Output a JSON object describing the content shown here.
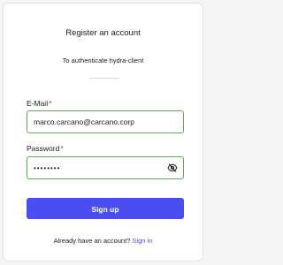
{
  "header": {
    "title": "Register an account",
    "subtitle": "To authenticate hydra-client"
  },
  "form": {
    "email": {
      "label": "E-Mail",
      "required_marker": "*",
      "value": "marco.carcano@carcano.corp"
    },
    "password": {
      "label": "Password",
      "required_marker": "*",
      "value": "password",
      "toggle_icon": "eye-off-icon"
    },
    "submit_label": "Sign up"
  },
  "footer": {
    "prompt": "Already have an account?",
    "link_label": "Sign in"
  },
  "colors": {
    "accent": "#4a4ef0",
    "valid_border": "#5aa84a",
    "required": "#c42b2b"
  }
}
